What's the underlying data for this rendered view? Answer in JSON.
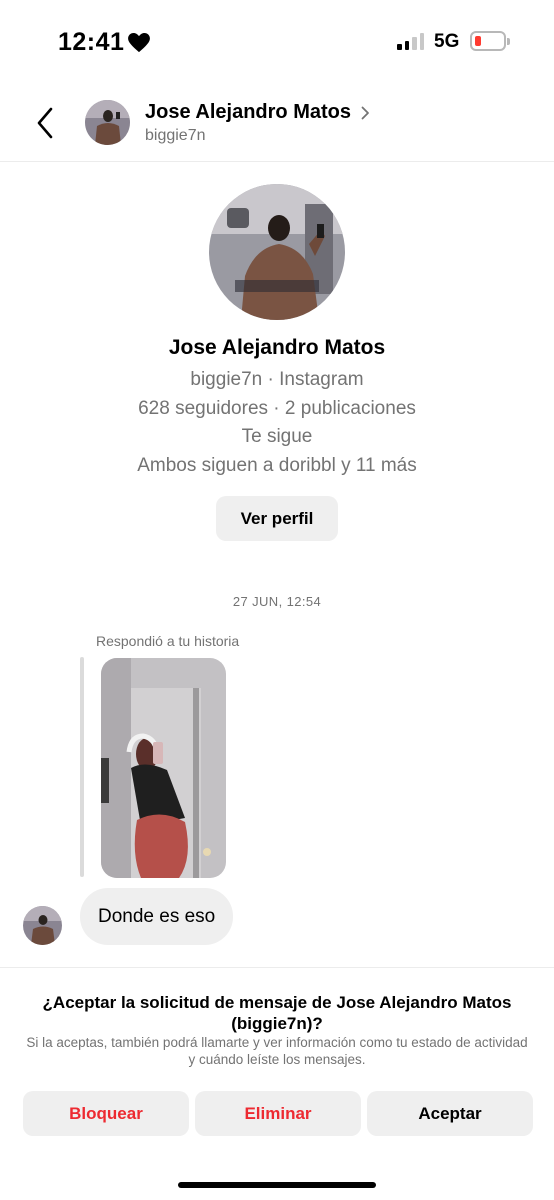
{
  "status_bar": {
    "time": "12:41",
    "network": "5G",
    "icons": [
      "heart-icon",
      "signal-icon",
      "battery-icon"
    ],
    "battery_level": 0.15,
    "battery_color": "#ff3b30"
  },
  "header": {
    "name": "Jose Alejandro Matos",
    "username": "biggie7n",
    "icons": [
      "chevron-left-icon",
      "chevron-right-icon"
    ]
  },
  "profile": {
    "name": "Jose Alejandro Matos",
    "source_line": "biggie7n · Instagram",
    "stats_line": "628 seguidores · 2 publicaciones",
    "follow_status": "Te sigue",
    "mutuals_line": "Ambos siguen a doribbl y 11 más",
    "view_profile_label": "Ver perfil"
  },
  "thread": {
    "date": "27 JUN, 12:54",
    "reply_note": "Respondió a tu historia",
    "message": "Donde es eso"
  },
  "request": {
    "title": "¿Aceptar la solicitud de mensaje de Jose Alejandro Matos (biggie7n)?",
    "subtitle": "Si la aceptas, también podrá llamarte y ver información como tu estado de actividad y cuándo leíste los mensajes.",
    "block_label": "Bloquear",
    "delete_label": "Eliminar",
    "accept_label": "Aceptar",
    "danger_color": "#ed2a31"
  }
}
